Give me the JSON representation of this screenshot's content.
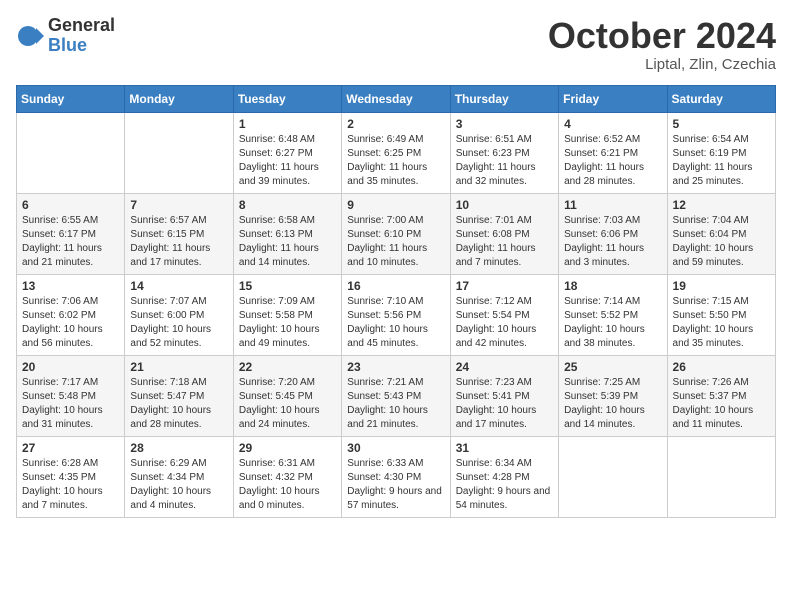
{
  "logo": {
    "general": "General",
    "blue": "Blue"
  },
  "title": "October 2024",
  "location": "Liptal, Zlin, Czechia",
  "days_of_week": [
    "Sunday",
    "Monday",
    "Tuesday",
    "Wednesday",
    "Thursday",
    "Friday",
    "Saturday"
  ],
  "weeks": [
    [
      {
        "day": "",
        "info": ""
      },
      {
        "day": "",
        "info": ""
      },
      {
        "day": "1",
        "info": "Sunrise: 6:48 AM\nSunset: 6:27 PM\nDaylight: 11 hours and 39 minutes."
      },
      {
        "day": "2",
        "info": "Sunrise: 6:49 AM\nSunset: 6:25 PM\nDaylight: 11 hours and 35 minutes."
      },
      {
        "day": "3",
        "info": "Sunrise: 6:51 AM\nSunset: 6:23 PM\nDaylight: 11 hours and 32 minutes."
      },
      {
        "day": "4",
        "info": "Sunrise: 6:52 AM\nSunset: 6:21 PM\nDaylight: 11 hours and 28 minutes."
      },
      {
        "day": "5",
        "info": "Sunrise: 6:54 AM\nSunset: 6:19 PM\nDaylight: 11 hours and 25 minutes."
      }
    ],
    [
      {
        "day": "6",
        "info": "Sunrise: 6:55 AM\nSunset: 6:17 PM\nDaylight: 11 hours and 21 minutes."
      },
      {
        "day": "7",
        "info": "Sunrise: 6:57 AM\nSunset: 6:15 PM\nDaylight: 11 hours and 17 minutes."
      },
      {
        "day": "8",
        "info": "Sunrise: 6:58 AM\nSunset: 6:13 PM\nDaylight: 11 hours and 14 minutes."
      },
      {
        "day": "9",
        "info": "Sunrise: 7:00 AM\nSunset: 6:10 PM\nDaylight: 11 hours and 10 minutes."
      },
      {
        "day": "10",
        "info": "Sunrise: 7:01 AM\nSunset: 6:08 PM\nDaylight: 11 hours and 7 minutes."
      },
      {
        "day": "11",
        "info": "Sunrise: 7:03 AM\nSunset: 6:06 PM\nDaylight: 11 hours and 3 minutes."
      },
      {
        "day": "12",
        "info": "Sunrise: 7:04 AM\nSunset: 6:04 PM\nDaylight: 10 hours and 59 minutes."
      }
    ],
    [
      {
        "day": "13",
        "info": "Sunrise: 7:06 AM\nSunset: 6:02 PM\nDaylight: 10 hours and 56 minutes."
      },
      {
        "day": "14",
        "info": "Sunrise: 7:07 AM\nSunset: 6:00 PM\nDaylight: 10 hours and 52 minutes."
      },
      {
        "day": "15",
        "info": "Sunrise: 7:09 AM\nSunset: 5:58 PM\nDaylight: 10 hours and 49 minutes."
      },
      {
        "day": "16",
        "info": "Sunrise: 7:10 AM\nSunset: 5:56 PM\nDaylight: 10 hours and 45 minutes."
      },
      {
        "day": "17",
        "info": "Sunrise: 7:12 AM\nSunset: 5:54 PM\nDaylight: 10 hours and 42 minutes."
      },
      {
        "day": "18",
        "info": "Sunrise: 7:14 AM\nSunset: 5:52 PM\nDaylight: 10 hours and 38 minutes."
      },
      {
        "day": "19",
        "info": "Sunrise: 7:15 AM\nSunset: 5:50 PM\nDaylight: 10 hours and 35 minutes."
      }
    ],
    [
      {
        "day": "20",
        "info": "Sunrise: 7:17 AM\nSunset: 5:48 PM\nDaylight: 10 hours and 31 minutes."
      },
      {
        "day": "21",
        "info": "Sunrise: 7:18 AM\nSunset: 5:47 PM\nDaylight: 10 hours and 28 minutes."
      },
      {
        "day": "22",
        "info": "Sunrise: 7:20 AM\nSunset: 5:45 PM\nDaylight: 10 hours and 24 minutes."
      },
      {
        "day": "23",
        "info": "Sunrise: 7:21 AM\nSunset: 5:43 PM\nDaylight: 10 hours and 21 minutes."
      },
      {
        "day": "24",
        "info": "Sunrise: 7:23 AM\nSunset: 5:41 PM\nDaylight: 10 hours and 17 minutes."
      },
      {
        "day": "25",
        "info": "Sunrise: 7:25 AM\nSunset: 5:39 PM\nDaylight: 10 hours and 14 minutes."
      },
      {
        "day": "26",
        "info": "Sunrise: 7:26 AM\nSunset: 5:37 PM\nDaylight: 10 hours and 11 minutes."
      }
    ],
    [
      {
        "day": "27",
        "info": "Sunrise: 6:28 AM\nSunset: 4:35 PM\nDaylight: 10 hours and 7 minutes."
      },
      {
        "day": "28",
        "info": "Sunrise: 6:29 AM\nSunset: 4:34 PM\nDaylight: 10 hours and 4 minutes."
      },
      {
        "day": "29",
        "info": "Sunrise: 6:31 AM\nSunset: 4:32 PM\nDaylight: 10 hours and 0 minutes."
      },
      {
        "day": "30",
        "info": "Sunrise: 6:33 AM\nSunset: 4:30 PM\nDaylight: 9 hours and 57 minutes."
      },
      {
        "day": "31",
        "info": "Sunrise: 6:34 AM\nSunset: 4:28 PM\nDaylight: 9 hours and 54 minutes."
      },
      {
        "day": "",
        "info": ""
      },
      {
        "day": "",
        "info": ""
      }
    ]
  ]
}
